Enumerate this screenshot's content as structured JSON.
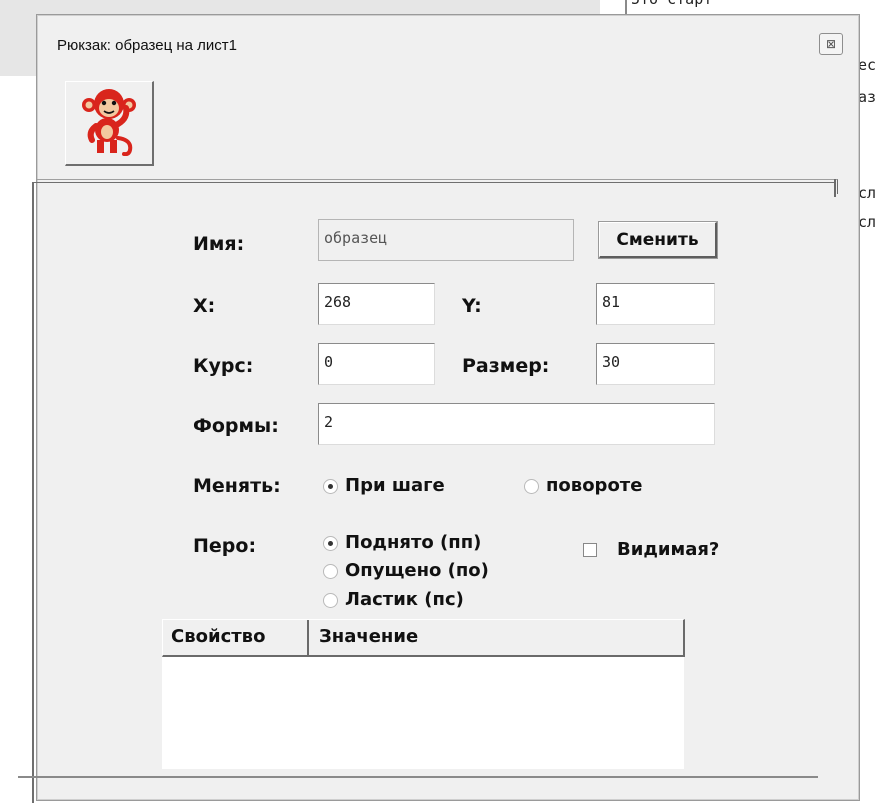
{
  "background": {
    "code_lines": [
      "5тб старт",
      "ес",
      "аз",
      "сл",
      "сл"
    ]
  },
  "dialog": {
    "title": "Рюкзак: образец на лист1",
    "close_glyph": "⊠",
    "sprite_icon": "monkey-icon"
  },
  "form": {
    "name_label": "Имя:",
    "name_value": "образец",
    "change_button": "Сменить",
    "x_label": "X:",
    "x_value": "268",
    "y_label": "Y:",
    "y_value": "81",
    "heading_label": "Курс:",
    "heading_value": "0",
    "size_label": "Размер:",
    "size_value": "30",
    "shapes_label": "Формы:",
    "shapes_value": "2",
    "change_on_label": "Менять:",
    "change_on_options": [
      {
        "label": "При шаге",
        "selected": true
      },
      {
        "label": "повороте",
        "selected": false
      }
    ],
    "pen_label": "Перо:",
    "pen_options": [
      {
        "label": "Поднято (пп)",
        "selected": true
      },
      {
        "label": "Опущено (по)",
        "selected": false
      },
      {
        "label": "Ластик (пс)",
        "selected": false
      }
    ],
    "visible_label": "Видимая?",
    "visible_checked": false
  },
  "properties_table": {
    "columns": [
      "Свойство",
      "Значение"
    ],
    "rows": []
  },
  "colors": {
    "dialog_bg": "#f0f0f0",
    "monkey_red": "#d9251c"
  }
}
